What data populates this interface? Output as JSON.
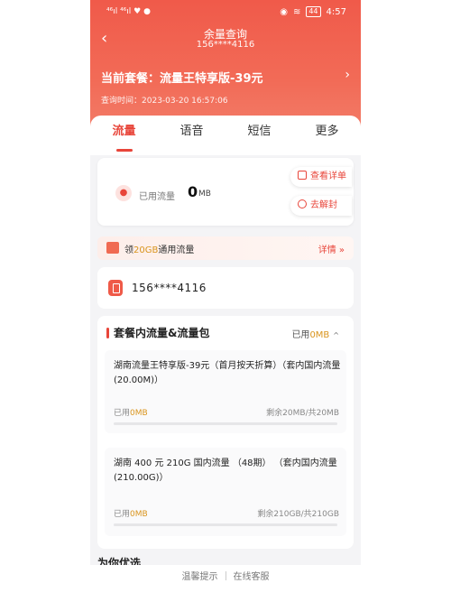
{
  "status_bar": {
    "time": "4:57",
    "battery": "44",
    "left_icons": "⁴⁶ıl ⁴⁶ıl ♥ ●"
  },
  "header": {
    "title": "余量查询",
    "phone": "156****4116",
    "plan_label": "当前套餐：",
    "plan_name": "流量王特享版-39元",
    "query_time_label": "查询时间：",
    "query_time": "2023-03-20 16:57:06"
  },
  "tabs": [
    "流量",
    "语音",
    "短信",
    "更多"
  ],
  "usage": {
    "label": "已用流量",
    "value": "0",
    "unit": "MB",
    "detail_label": "查看详单",
    "unlock_label": "去解封"
  },
  "promo": {
    "prefix": "领",
    "highlight": "20GB",
    "suffix": "通用流量",
    "link": "详情 »"
  },
  "number_card": {
    "number": "156****4116"
  },
  "package_section": {
    "title": "套餐内流量&流量包",
    "used_label": "已用",
    "used_value": "0MB",
    "items": [
      {
        "name": "湖南流量王特享版-39元（首月按天折算）（套内国内流量(20.00M)）",
        "used_label": "已用",
        "used_value": "0MB",
        "remain": "剩余20MB/共20MB",
        "used_fraction": 0
      },
      {
        "name": "湖南 400 元 210G 国内流量 （48期） （套内国内流量(210.00G)）",
        "used_label": "已用",
        "used_value": "0MB",
        "remain": "剩余210GB/共210GB",
        "used_fraction": 0
      }
    ]
  },
  "recommend_title": "为你优选",
  "footer": {
    "tips": "温馨提示",
    "service": "在线客服"
  },
  "colors": {
    "accent": "#e8453a",
    "highlight": "#d9941d",
    "header_bg": "#f05a4a"
  },
  "icons": {
    "back": "chevron-left-icon",
    "plan_arrow": "chevron-right-icon",
    "usage": "data-usage-icon",
    "detail": "bill-icon",
    "unlock": "lock-icon",
    "promo": "gift-icon",
    "number": "sim-card-icon"
  }
}
